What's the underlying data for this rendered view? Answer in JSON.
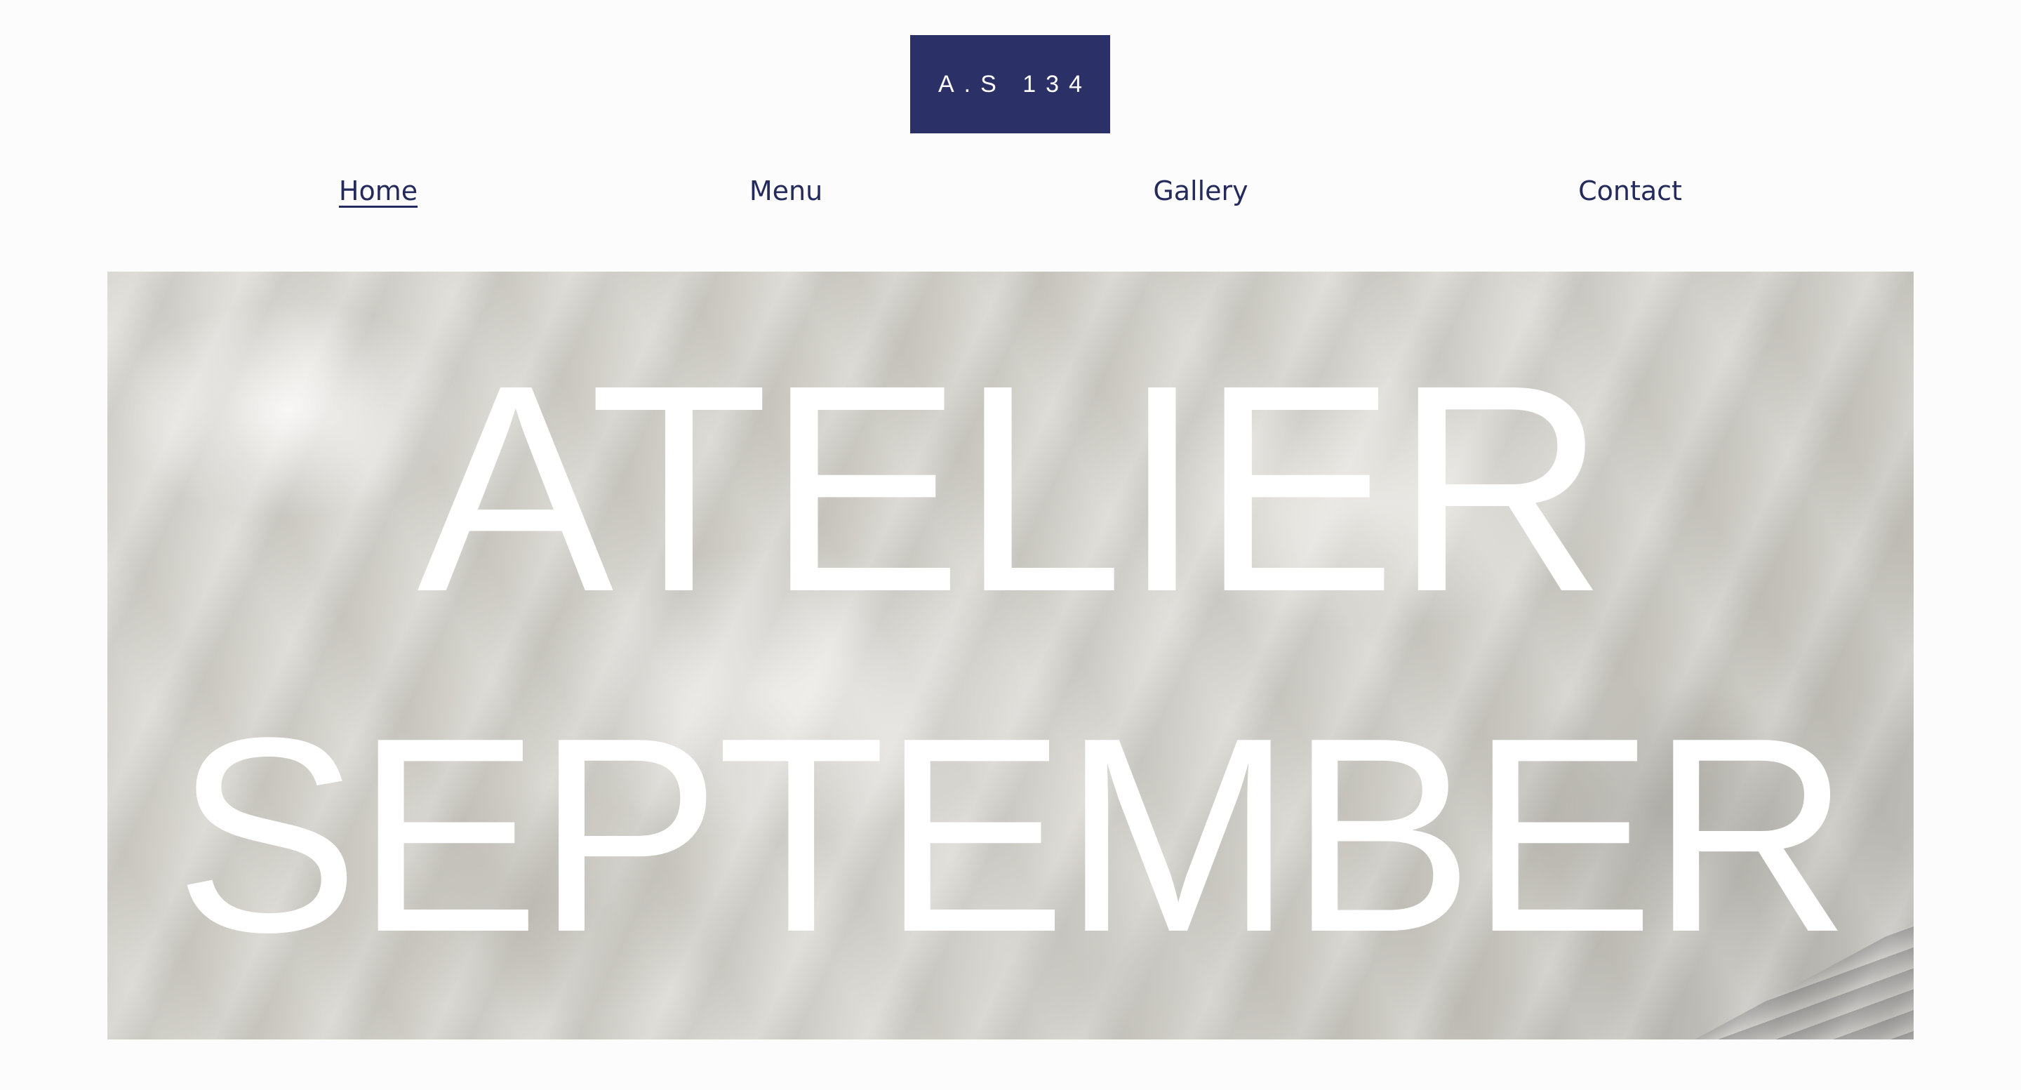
{
  "brand": {
    "logo_text": "A.S 134",
    "logo_bg_color": "#2b3066"
  },
  "nav": {
    "items": [
      {
        "label": "Home",
        "active": true
      },
      {
        "label": "Menu",
        "active": false
      },
      {
        "label": "Gallery",
        "active": false
      },
      {
        "label": "Contact",
        "active": false
      }
    ],
    "text_color": "#242a5c"
  },
  "hero": {
    "title_line_1": "ATELIER",
    "title_line_2": "SEPTEMBER",
    "title_color": "#ffffff",
    "image_subject": "whipped cream frosting texture"
  }
}
